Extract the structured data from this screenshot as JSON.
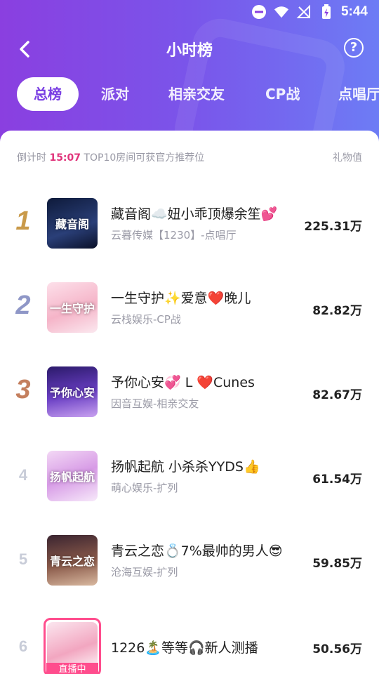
{
  "status_bar": {
    "time": "5:44"
  },
  "header": {
    "title": "小时榜"
  },
  "tabs": [
    {
      "label": "总榜",
      "active": true
    },
    {
      "label": "派对"
    },
    {
      "label": "相亲交友"
    },
    {
      "label": "CP战"
    },
    {
      "label": "点唱厅"
    }
  ],
  "info": {
    "countdown_prefix": "倒计时 ",
    "countdown_time": "15:07",
    "countdown_suffix": " TOP10房间可获官方推荐位",
    "gift_label": "礼物值"
  },
  "ranking": [
    {
      "rank": "1",
      "title": "藏音阁☁️妞小乖顶爆余笙💕",
      "subtitle": "云暮传媒【1230】-点唱厅",
      "value": "225.31万",
      "avatar_text": "藏音阁",
      "color": "#c99a4a"
    },
    {
      "rank": "2",
      "title": "一生守护✨爱意❤️晚儿",
      "subtitle": "云栈娱乐-CP战",
      "value": "82.82万",
      "avatar_text": "一生守护",
      "color": "#8f97c7"
    },
    {
      "rank": "3",
      "title": "予你心安💞 L ❤️Cunes",
      "subtitle": "因音互娱-相亲交友",
      "value": "82.67万",
      "avatar_text": "予你心安",
      "color": "#c47f5e"
    },
    {
      "rank": "4",
      "title": "扬帆起航 小杀杀YYDS👍",
      "subtitle": "萌心娱乐-扩列",
      "value": "61.54万",
      "avatar_text": "扬帆起航",
      "color": "#c8ccd8"
    },
    {
      "rank": "5",
      "title": "青云之恋💍7%最帅的男人😎",
      "subtitle": "沧海互娱-扩列",
      "value": "59.85万",
      "avatar_text": "青云之恋",
      "color": "#c8ccd8"
    },
    {
      "rank": "6",
      "title": "1226🏝️等等🎧新人测播",
      "subtitle": "",
      "value": "50.56万",
      "avatar_text": "",
      "live_label": "直播中",
      "color": "#c8ccd8"
    }
  ],
  "colors": {
    "accent": "#7a3fe3",
    "countdown_highlight": "#e0337a",
    "live": "#ff4d8d"
  }
}
